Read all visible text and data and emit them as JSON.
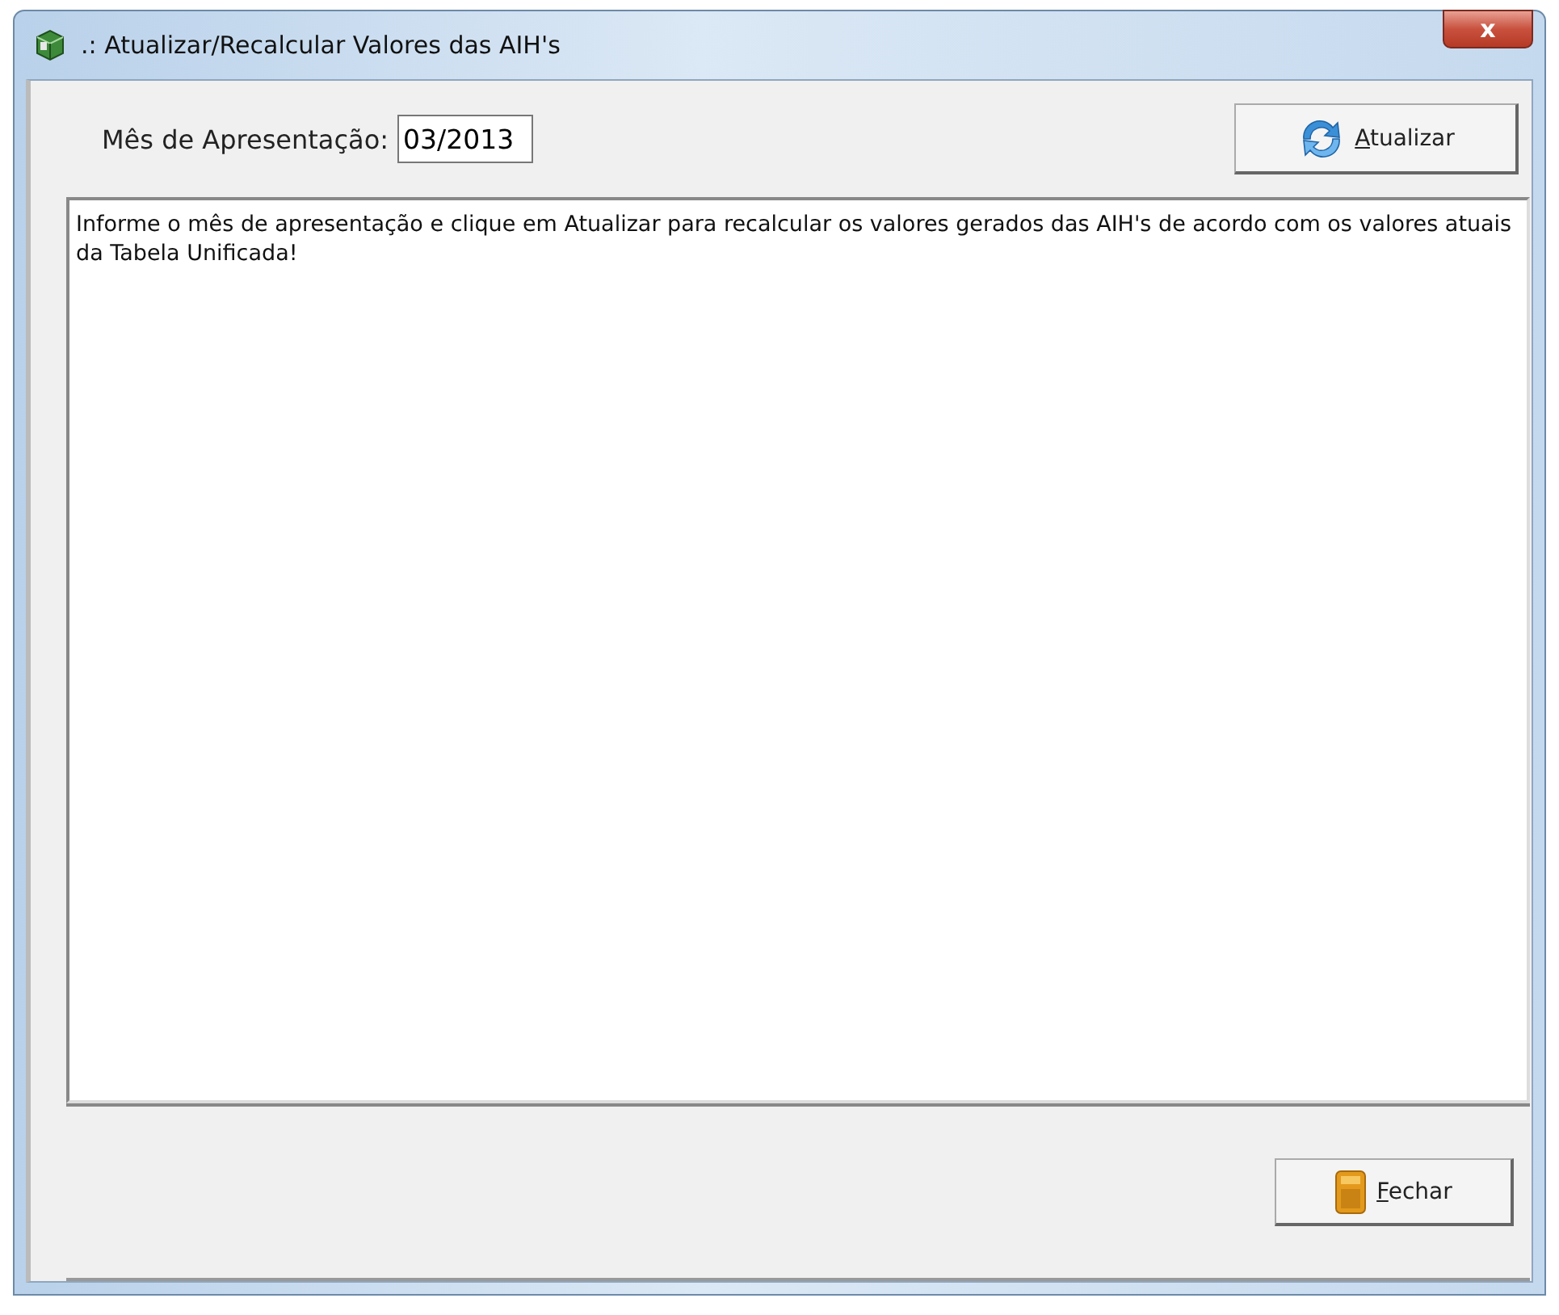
{
  "window": {
    "title": ".: Atualizar/Recalcular Valores das AIH's",
    "close_label": "x"
  },
  "form": {
    "label": "Mês de Apresentação:",
    "value": "03/2013"
  },
  "buttons": [
    {
      "label": "Atualizar",
      "kind": "refresh",
      "access_key_underlined": true
    },
    {
      "label": "Fechar",
      "kind": "close",
      "access_key_underlined": true
    }
  ],
  "message": "Informe o mês de apresentação e clique em Atualizar para recalcular os valores gerados das AIH's de acordo com os valores atuais da Tabela Unificada!"
}
